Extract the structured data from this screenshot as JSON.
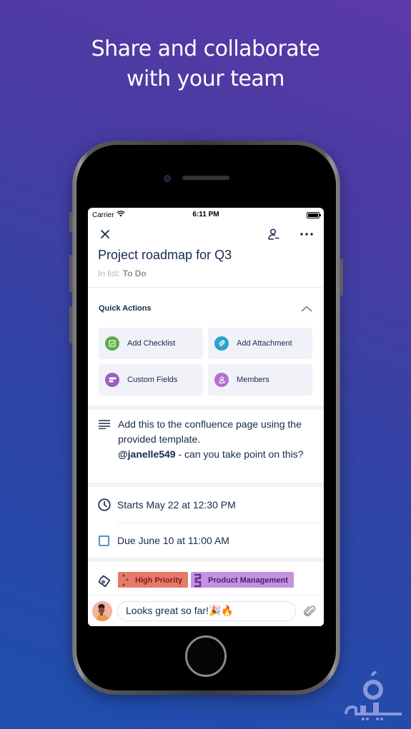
{
  "headline": {
    "line1": "Share and collaborate",
    "line2": "with your team"
  },
  "status_bar": {
    "carrier": "Carrier",
    "time": "6:11 PM",
    "battery_level": 1.0
  },
  "card": {
    "title": "Project roadmap for Q3",
    "in_list_prefix": "In list:",
    "list_name": "To Do"
  },
  "quick_actions": {
    "header": "Quick Actions",
    "items": [
      {
        "label": "Add Checklist",
        "icon": "checklist-icon",
        "color": "#5aac44"
      },
      {
        "label": "Add Attachment",
        "icon": "paperclip-icon",
        "color": "#29a4c8"
      },
      {
        "label": "Custom Fields",
        "icon": "fields-icon",
        "color": "#9b5fc4"
      },
      {
        "label": "Members",
        "icon": "person-icon",
        "color": "#b46fd3"
      }
    ]
  },
  "description": {
    "text1": "Add this to the confluence page using the provided template.",
    "mention": "@janelle549",
    "text2": " - can you take point on this?"
  },
  "dates": {
    "start": "Starts May 22 at 12:30 PM",
    "due": "Due June 10 at 11:00 AM"
  },
  "labels": [
    {
      "name": "High Priority",
      "color": "#e57a6a",
      "text_color": "#7a1e12"
    },
    {
      "name": "Product Management",
      "color": "#c493e0",
      "text_color": "#4a1d6e"
    }
  ],
  "comment": {
    "value": "Looks great so far!🎉🔥"
  }
}
